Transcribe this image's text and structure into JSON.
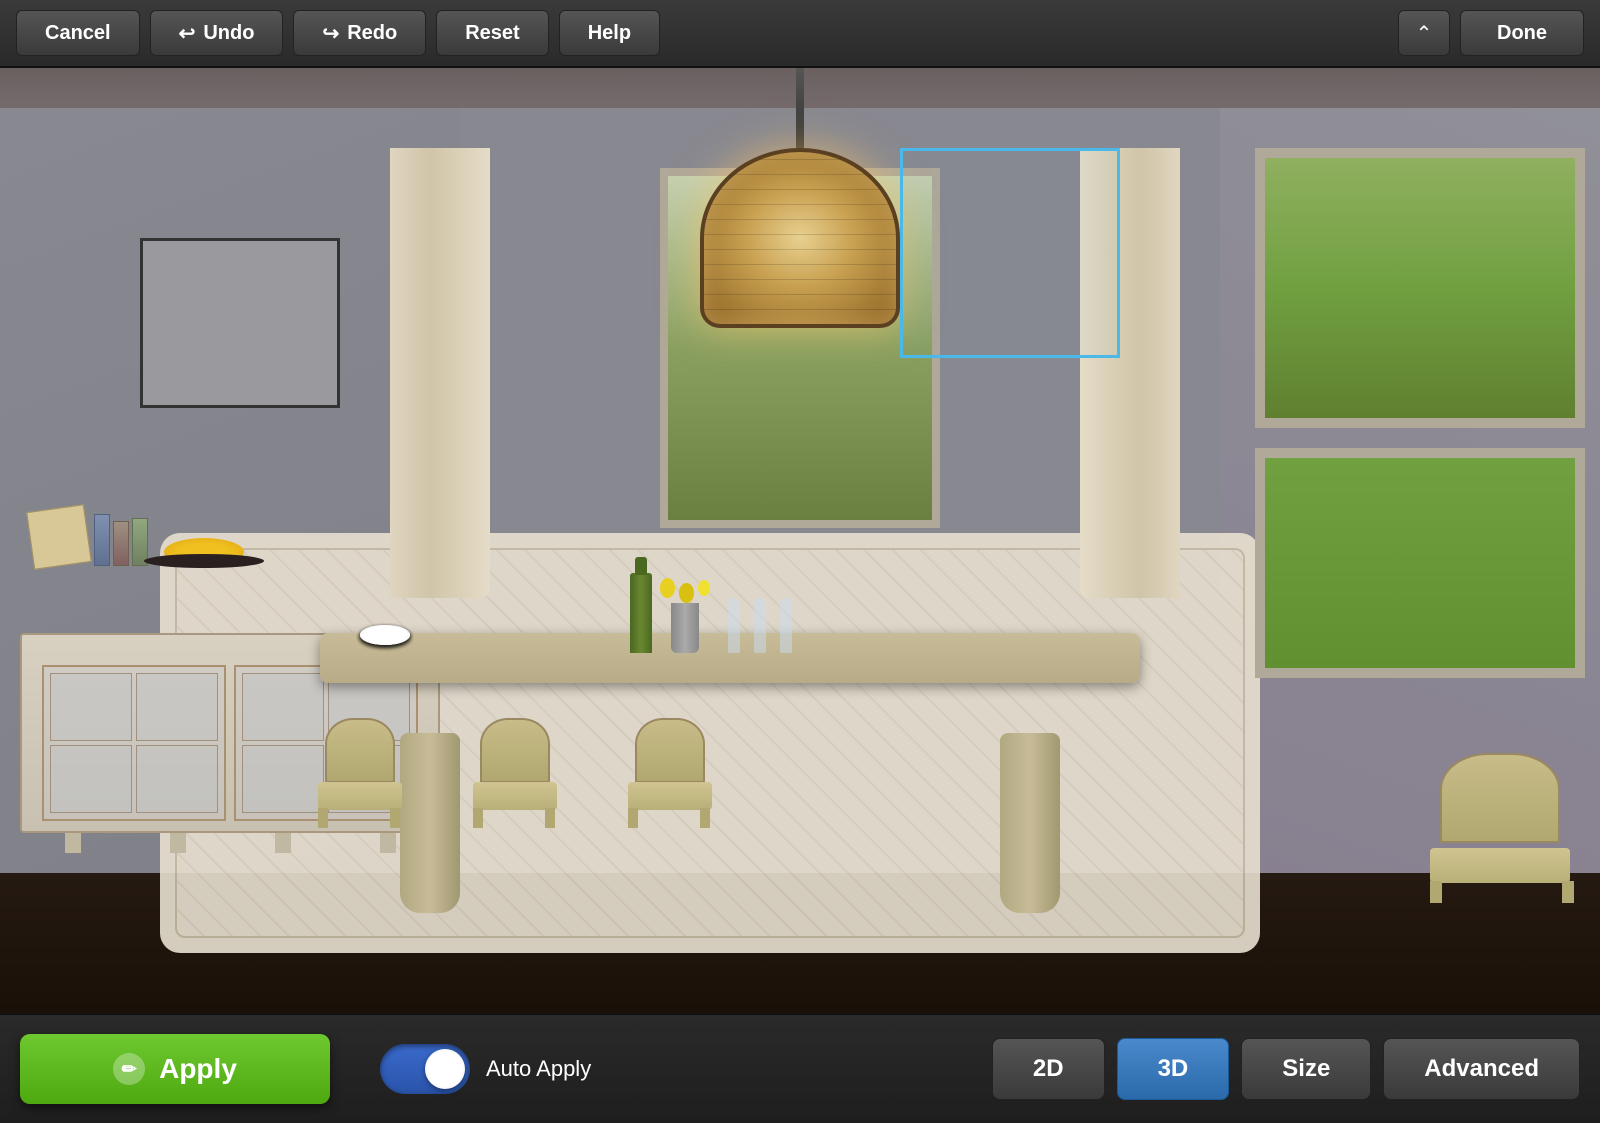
{
  "toolbar": {
    "cancel_label": "Cancel",
    "undo_label": "Undo",
    "redo_label": "Redo",
    "reset_label": "Reset",
    "help_label": "Help",
    "done_label": "Done"
  },
  "bottom_toolbar": {
    "apply_label": "Apply",
    "apply_icon": "✏",
    "auto_apply_label": "Auto Apply",
    "btn_2d": "2D",
    "btn_3d": "3D",
    "btn_size": "Size",
    "btn_advanced": "Advanced"
  },
  "scene": {
    "room_description": "Dining room 3D view"
  }
}
